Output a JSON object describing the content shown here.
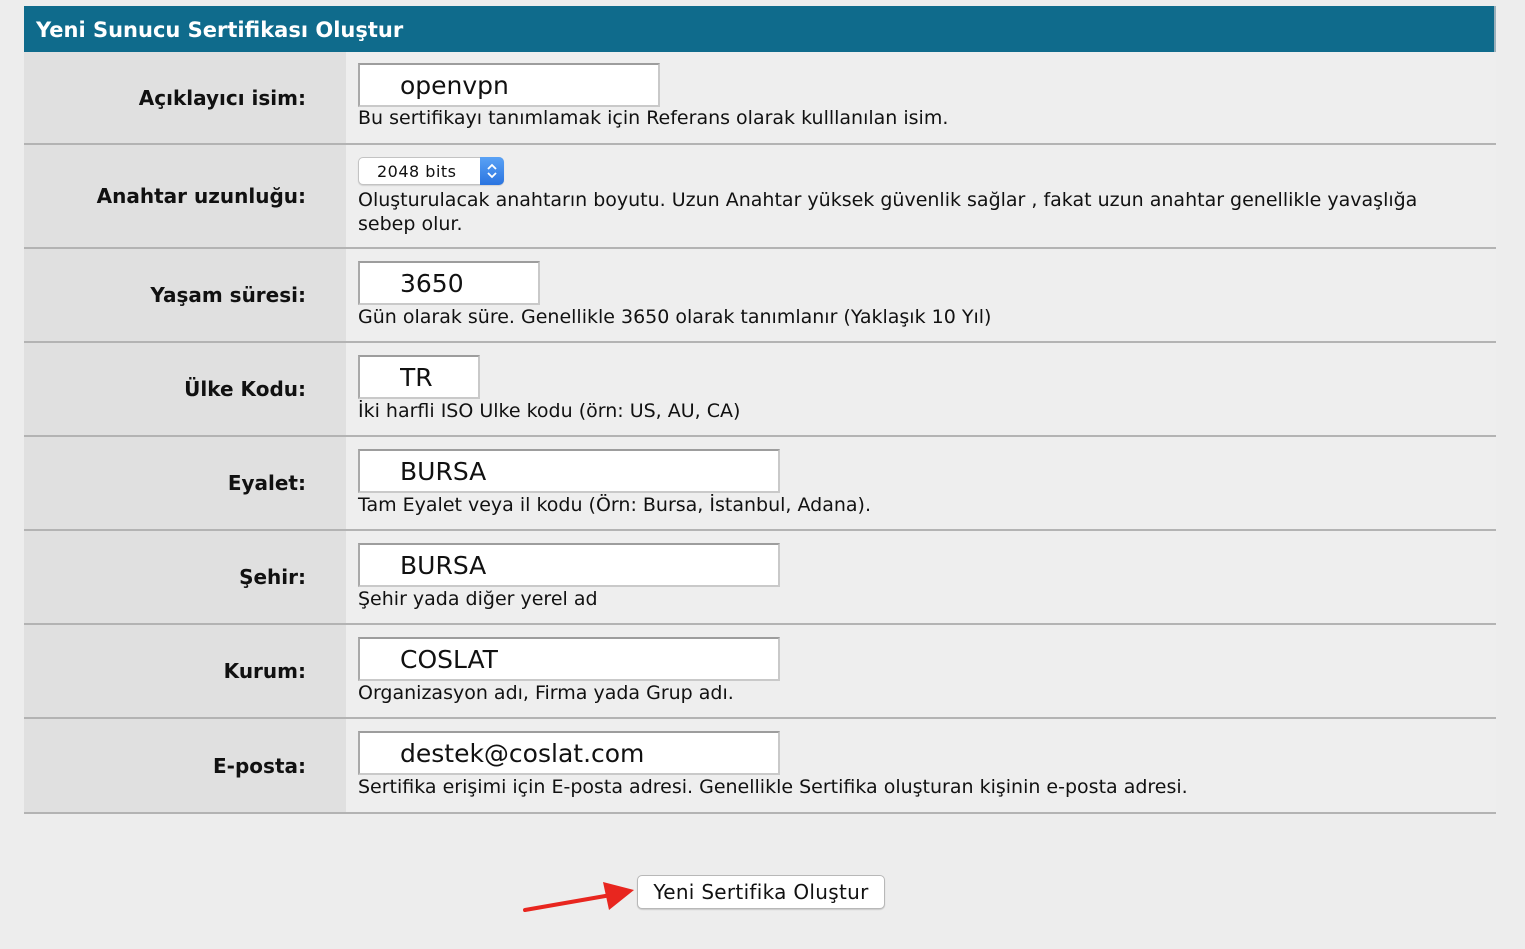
{
  "form": {
    "title": "Yeni Sunucu Sertifikası Oluştur",
    "fields": [
      {
        "label": "Açıklayıcı isim:",
        "value": "openvpn",
        "hint": "Bu sertifikayı tanımlamak için Referans olarak kulllanılan isim."
      },
      {
        "label": "Anahtar uzunluğu:",
        "value": "2048 bits",
        "hint": "Oluşturulacak anahtarın boyutu. Uzun Anahtar yüksek güvenlik sağlar , fakat uzun anahtar genellikle yavaşlığa sebep olur."
      },
      {
        "label": "Yaşam süresi:",
        "value": "3650",
        "hint": "Gün olarak süre. Genellikle 3650 olarak tanımlanır (Yaklaşık 10 Yıl)"
      },
      {
        "label": "Ülke Kodu:",
        "value": "TR",
        "hint": "İki harfli ISO Ulke kodu (örn: US, AU, CA)"
      },
      {
        "label": "Eyalet:",
        "value": "BURSA",
        "hint": "Tam Eyalet veya il kodu (Örn: Bursa, İstanbul, Adana)."
      },
      {
        "label": "Şehir:",
        "value": "BURSA",
        "hint": "Şehir yada diğer yerel ad"
      },
      {
        "label": "Kurum:",
        "value": "COSLAT",
        "hint": "Organizasyon adı, Firma yada Grup adı."
      },
      {
        "label": "E-posta:",
        "value": "destek@coslat.com",
        "hint": "Sertifika erişimi için E-posta adresi. Genellikle Sertifika oluşturan kişinin e-posta adresi."
      }
    ],
    "submit_label": "Yeni Sertifika Oluştur"
  },
  "colors": {
    "title_bar": "#0f6b8c",
    "arrow": "#e8261f"
  },
  "icons": {
    "select": "chevron-up-down-icon",
    "annotation": "red-arrow-icon"
  }
}
